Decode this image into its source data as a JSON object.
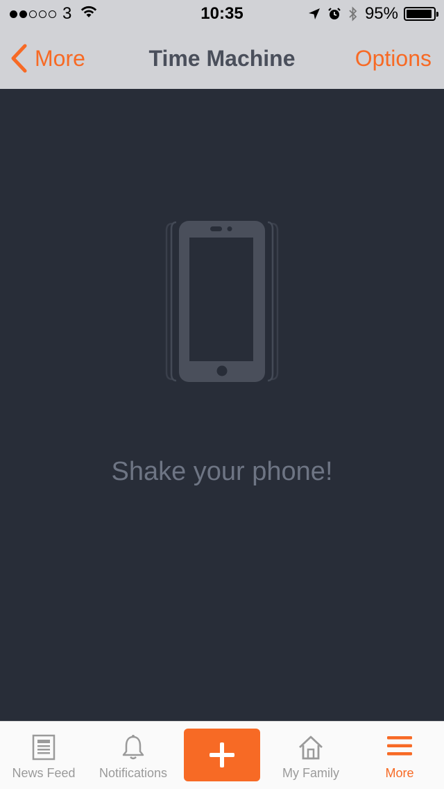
{
  "status_bar": {
    "carrier": "3",
    "time": "10:35",
    "battery_percent": "95%",
    "battery_level": 0.95,
    "signal_filled": 2,
    "signal_total": 5
  },
  "nav": {
    "back_label": "More",
    "title": "Time Machine",
    "options_label": "Options"
  },
  "main": {
    "message": "Shake your phone!"
  },
  "tabbar": {
    "items": [
      {
        "label": "News Feed",
        "icon": "newspaper-icon",
        "active": false
      },
      {
        "label": "Notifications",
        "icon": "bell-icon",
        "active": false
      },
      {
        "label": "",
        "icon": "plus-icon",
        "active": false
      },
      {
        "label": "My Family",
        "icon": "house-icon",
        "active": false
      },
      {
        "label": "More",
        "icon": "hamburger-menu-icon",
        "active": true
      }
    ]
  },
  "colors": {
    "accent": "#f76a25",
    "background": "#282d38",
    "header": "#d1d2d6",
    "phone_icon": "#4a4f5b",
    "message_text": "#6e7584"
  }
}
